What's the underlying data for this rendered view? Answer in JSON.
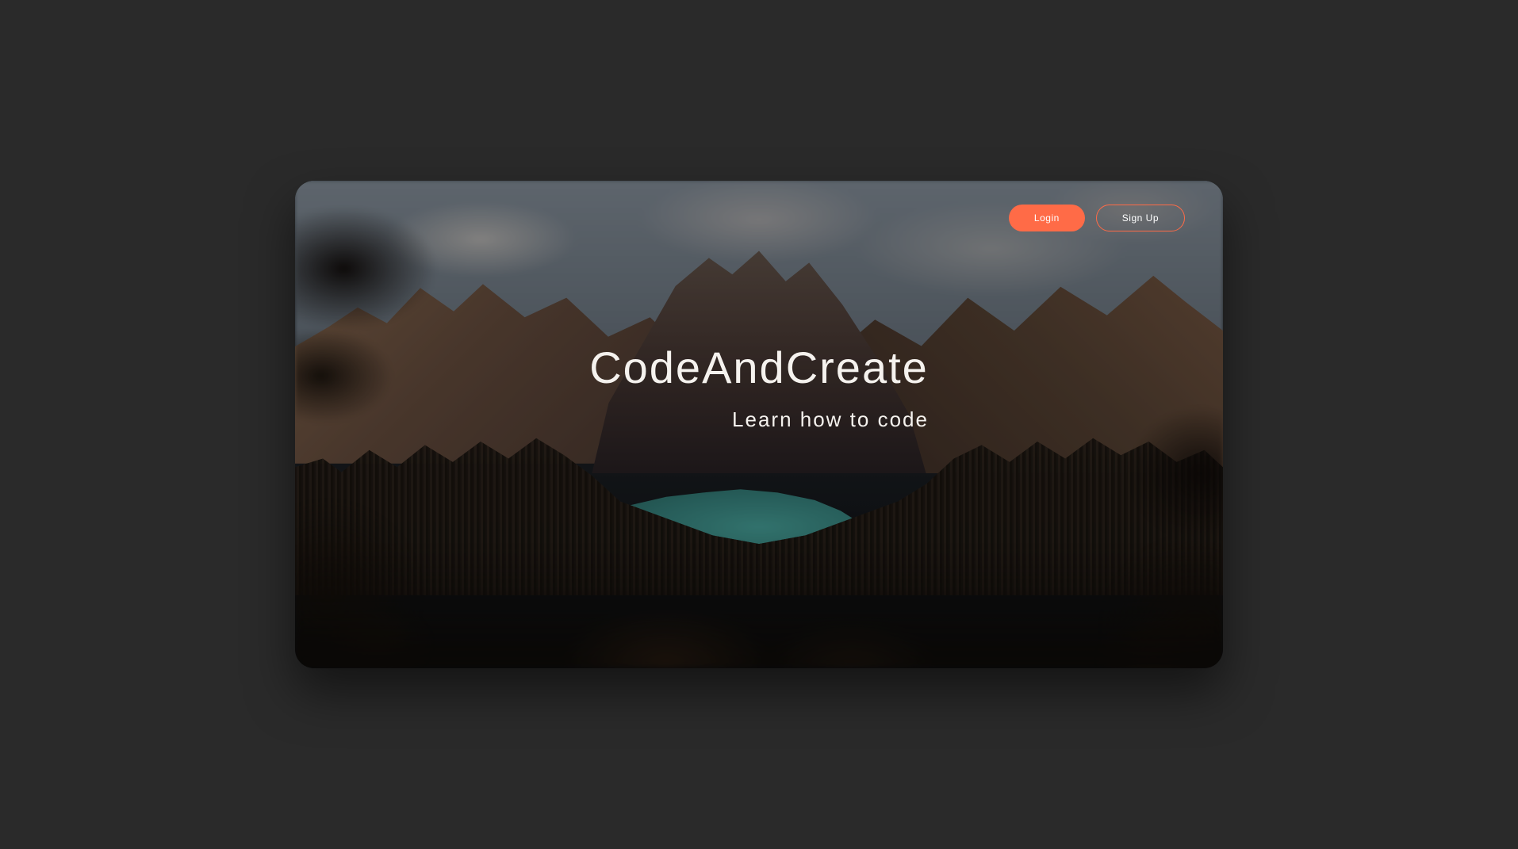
{
  "header": {
    "login_label": "Login",
    "signup_label": "Sign Up"
  },
  "hero": {
    "title": "CodeAndCreate",
    "subtitle": "Learn how to code"
  },
  "colors": {
    "accent": "#ff6b47",
    "text": "#f5f2ee",
    "page_bg": "#2a2a2a"
  }
}
